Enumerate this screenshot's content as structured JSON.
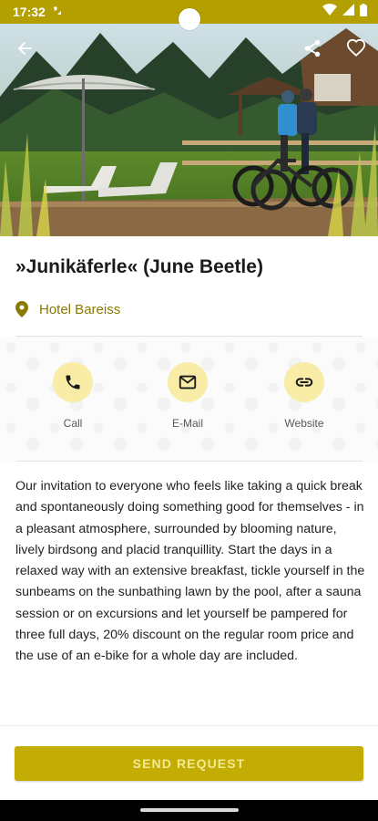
{
  "status_bar": {
    "time": "17:32",
    "background": "#b3a000",
    "icons": [
      "notification-icon",
      "wifi-icon",
      "cellular-signal-icon",
      "battery-icon"
    ]
  },
  "hero": {
    "image": "photo of a lodge sunbathing lawn with parasol, loungers and two cyclists with e-bikes",
    "buttons": [
      "back-arrow-icon",
      "share-icon",
      "favorite-heart-icon"
    ]
  },
  "offer": {
    "title": "»Junikäferle« (June Beetle)",
    "location_icon": "location-pin-icon",
    "hotel": "Hotel Bareiss"
  },
  "actions": [
    {
      "icon": "phone-icon",
      "label": "Call"
    },
    {
      "icon": "mail-icon",
      "label": "E-Mail"
    },
    {
      "icon": "link-icon",
      "label": "Website"
    }
  ],
  "description": "Our invitation to everyone who feels like taking a quick break and spontaneously doing something good for themselves - in a pleasant atmosphere, surrounded by blooming nature, lively birdsong and placid tranquillity. Start the days in a relaxed way with an extensive breakfast, tickle yourself in the sunbeams on the sunbathing lawn by the pool, after a sauna session or on excursions and let yourself be pampered for three full days, 20% discount on the regular room price and the use of an e-bike for a whole day are included.",
  "cta": {
    "label": "SEND REQUEST"
  },
  "colors": {
    "accent": "#b3a000",
    "button": "#c3ad05",
    "icon_circle": "#f8eca6"
  }
}
